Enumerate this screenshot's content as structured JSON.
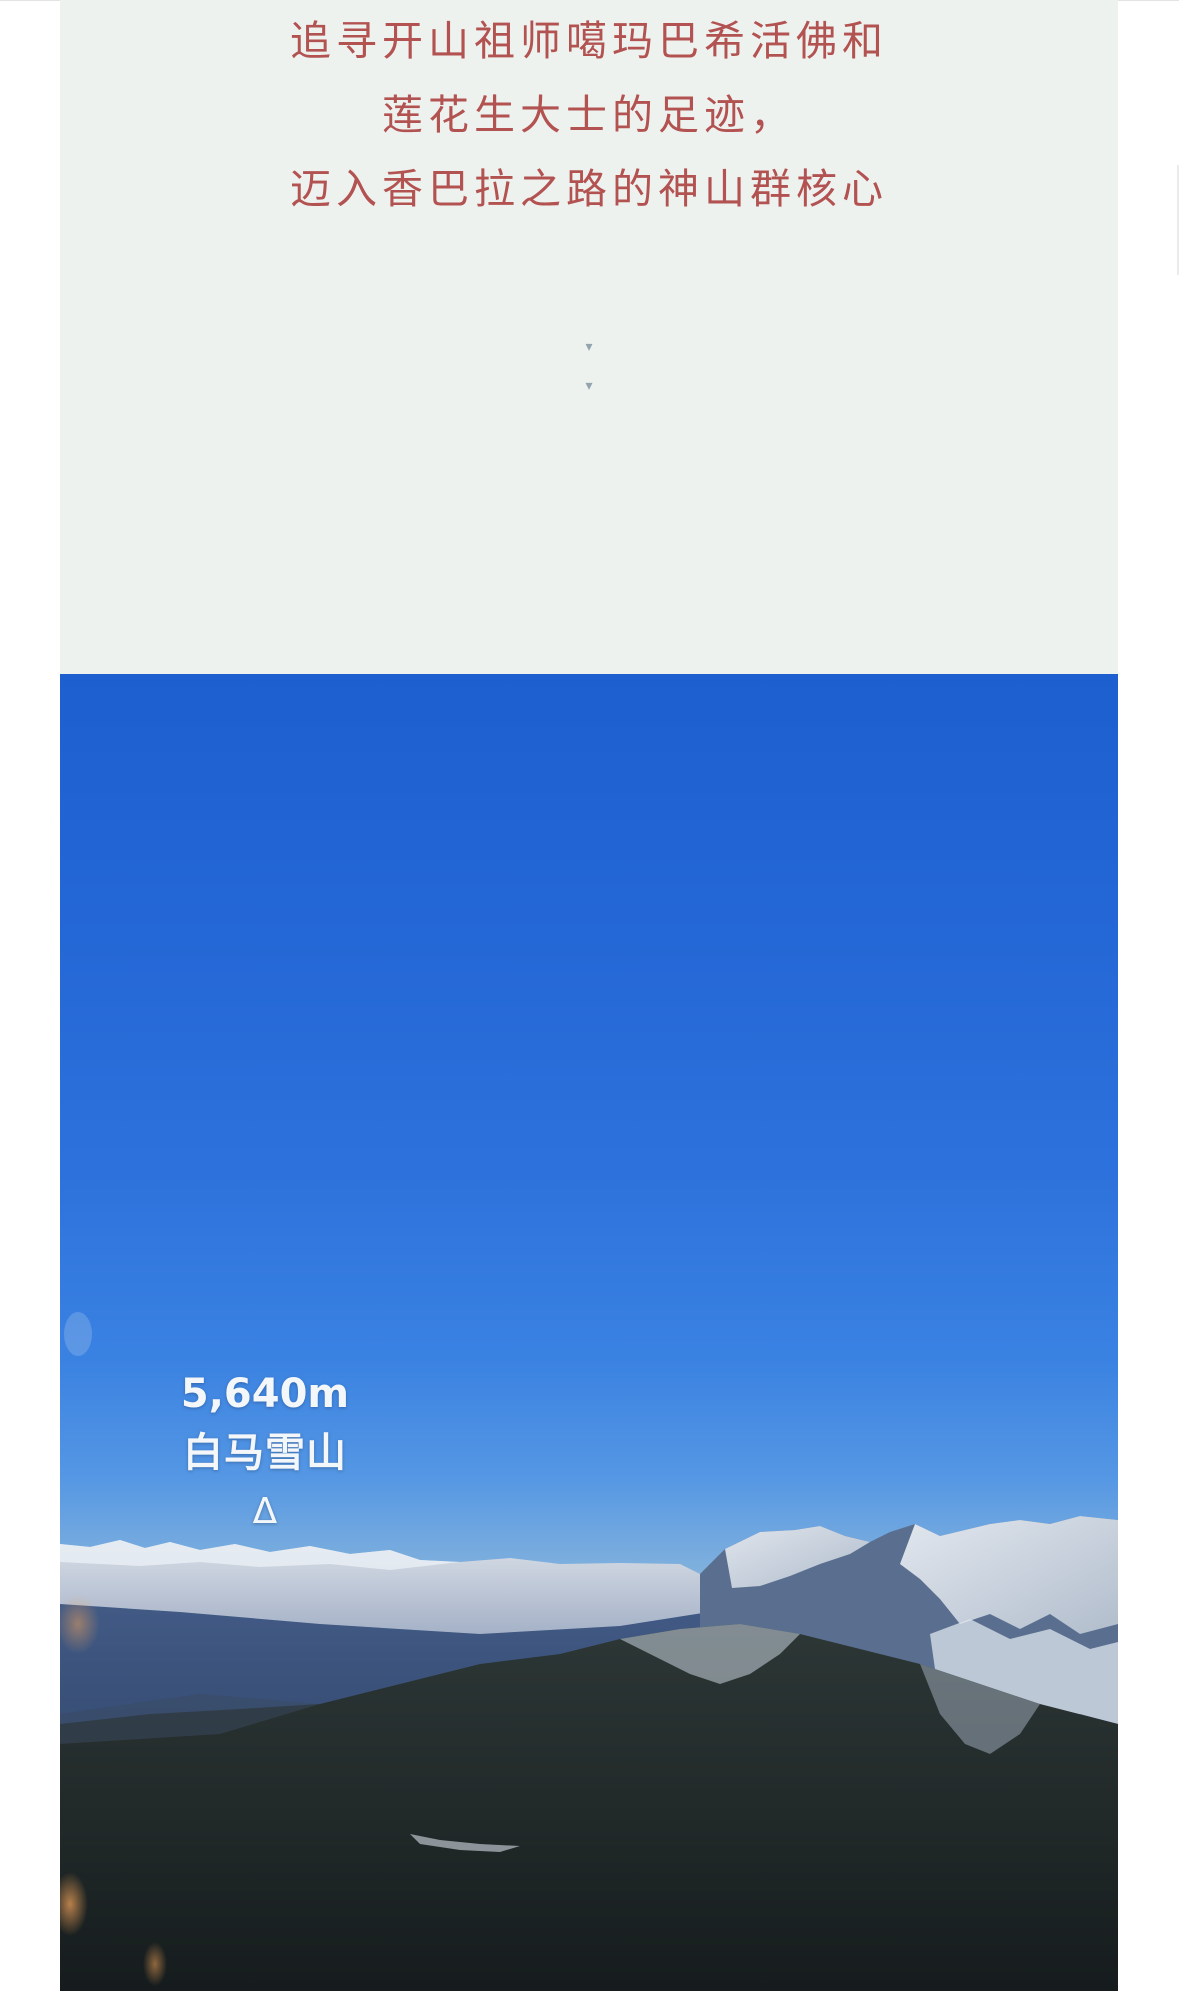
{
  "intro": {
    "lines": [
      "追寻开山祖师噶玛巴希活佛和",
      "莲花生大士的足迹，",
      "迈入香巴拉之路的神山群核心"
    ],
    "scroll_hint_icon": "▾"
  },
  "photo": {
    "peak_elevation": "5,640m",
    "peak_name": "白马雪山",
    "peak_marker": "Δ"
  },
  "colors": {
    "intro_background": "#eef2ef",
    "poem_text": "#b25352",
    "scroll_hint": "#93a4ae",
    "sky_top": "#1e5fcf",
    "horizon_glow": "#f0b257"
  }
}
